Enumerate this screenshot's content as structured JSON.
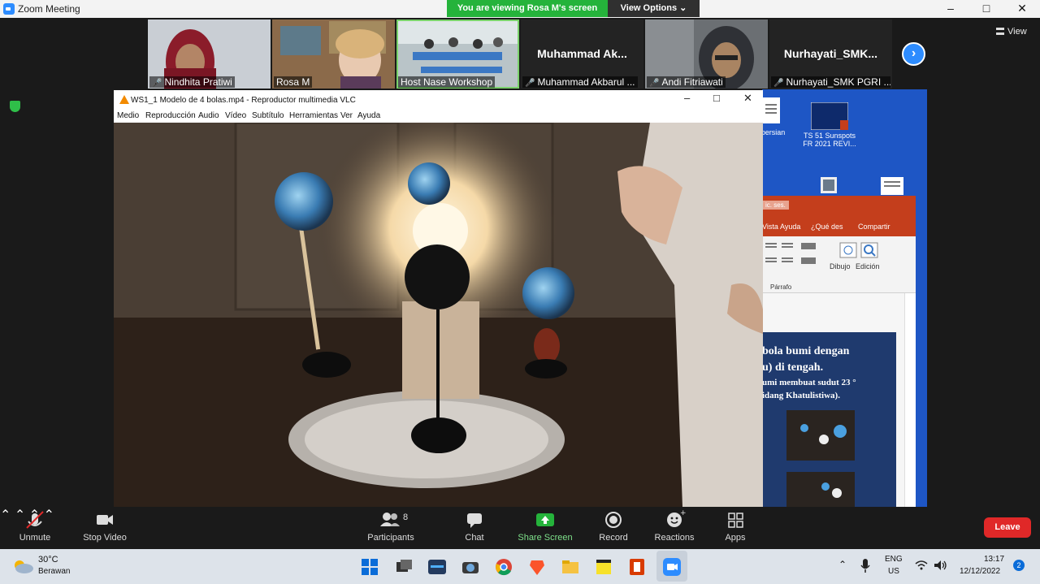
{
  "window": {
    "title": "Zoom Meeting",
    "minimize": "–",
    "maximize": "□",
    "close": "✕"
  },
  "share_banner": {
    "text": "You are viewing Rosa M's screen",
    "view_options": "View Options ⌄"
  },
  "view_button": {
    "label": "View"
  },
  "participants_strip": [
    {
      "name": "Nindhita Pratiwi",
      "muted": true,
      "has_video": true
    },
    {
      "name": "Rosa M",
      "muted": false,
      "has_video": true
    },
    {
      "name": "Host Nase Workshop",
      "muted": false,
      "has_video": true,
      "active": true
    },
    {
      "name": "Muhammad Akbarul ...",
      "big_name": "Muhammad  Ak...",
      "muted": true,
      "has_video": false
    },
    {
      "name": "Andi Fitriawati",
      "muted": true,
      "has_video": true
    },
    {
      "name": "Nurhayati_SMK PGRI ...",
      "big_name": "Nurhayati_SMK...",
      "muted": true,
      "has_video": false
    }
  ],
  "vlc": {
    "title": "WS1_1 Modelo de 4 bolas.mp4 - Reproductor multimedia VLC",
    "menu": [
      "Medio",
      "Reproducción",
      "Audio",
      "Vídeo",
      "Subtítulo",
      "Herramientas",
      "Ver",
      "Ayuda"
    ]
  },
  "desktop": {
    "icons": [
      {
        "label": "_persian"
      },
      {
        "label": "TS 51 Sunspots FR 2021 REVI..."
      }
    ]
  },
  "powerpoint": {
    "tab": "ic. ses.",
    "menu": [
      "Vista",
      "Ayuda",
      "¿Qué des",
      "Compartir"
    ],
    "ribbon": {
      "dibujo": "Dibujo",
      "edicion": "Edición",
      "parrafo": "Párrafo"
    },
    "slide_lines": [
      "bola bumi dengan",
      "u) di tengah.",
      "umi membuat sudut 23 °",
      "idang Khatulistiwa)."
    ]
  },
  "toolbar": {
    "unmute": "Unmute",
    "stop_video": "Stop Video",
    "participants": "Participants",
    "participants_count": "8",
    "chat": "Chat",
    "share_screen": "Share Screen",
    "record": "Record",
    "reactions": "Reactions",
    "apps": "Apps",
    "leave": "Leave"
  },
  "taskbar": {
    "weather_temp": "30°C",
    "weather_desc": "Berawan",
    "lang_top": "ENG",
    "lang_bottom": "US",
    "time": "13:17",
    "date": "12/12/2022",
    "notifications": "2"
  },
  "colors": {
    "zoom_blue": "#2d8cff",
    "share_green": "#25b33b",
    "leave_red": "#e02828",
    "ppt_red": "#c43e1c",
    "desktop_blue": "#1e56c5"
  }
}
